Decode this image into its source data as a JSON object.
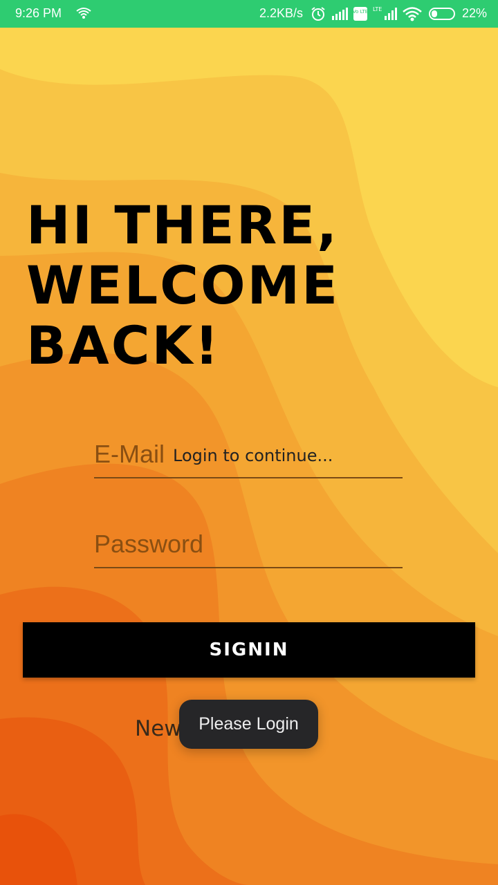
{
  "status_bar": {
    "time": "9:26 PM",
    "network_speed": "2.2KB/s",
    "battery_percent": "22%",
    "volte_label": "Vo LTE",
    "lte_label": "LTE",
    "background": "#2ecc71",
    "icons": [
      "wifi-icon",
      "alarm-icon",
      "signal-icon",
      "volte-icon",
      "lte-signal-icon",
      "wifi-icon",
      "battery-icon"
    ]
  },
  "welcome": {
    "line1": "HI THERE,",
    "line2": "WELCOME",
    "line3": "BACK!"
  },
  "form": {
    "email_placeholder": "E-Mail",
    "password_placeholder": "Password",
    "hint": "Login to continue..."
  },
  "signin_label": "SIGNIN",
  "signup_prompt": "New? Sign Up",
  "toast": "Please Login",
  "colors": {
    "gradient_light": "#fbd54f",
    "gradient_dark": "#e8520b",
    "button": "#000000",
    "toast": "#262628"
  }
}
